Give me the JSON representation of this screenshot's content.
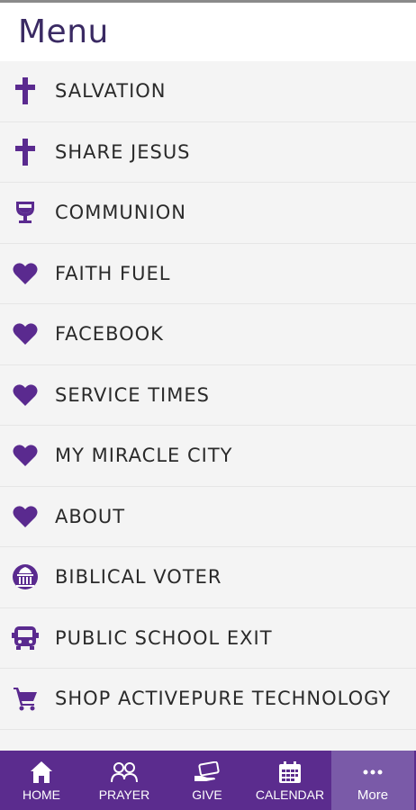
{
  "header": {
    "title": "Menu"
  },
  "colors": {
    "accent": "#5b2c8e",
    "active_tab": "#7a5aa8",
    "icon": "#5a2a8f"
  },
  "menu": {
    "items": [
      {
        "label": "SALVATION",
        "icon": "cross-icon"
      },
      {
        "label": "SHARE JESUS",
        "icon": "cross-icon"
      },
      {
        "label": "COMMUNION",
        "icon": "chalice-icon"
      },
      {
        "label": "FAITH FUEL",
        "icon": "heart-icon"
      },
      {
        "label": "FACEBOOK",
        "icon": "heart-icon"
      },
      {
        "label": "SERVICE TIMES",
        "icon": "heart-icon"
      },
      {
        "label": "MY MIRACLE CITY",
        "icon": "heart-icon"
      },
      {
        "label": "ABOUT",
        "icon": "heart-icon"
      },
      {
        "label": "BIBLICAL VOTER",
        "icon": "capitol-icon"
      },
      {
        "label": "PUBLIC SCHOOL EXIT",
        "icon": "bus-icon"
      },
      {
        "label": "SHOP ACTIVEPURE TECHNOLOGY",
        "icon": "cart-icon"
      }
    ]
  },
  "tabbar": {
    "tabs": [
      {
        "label": "HOME",
        "icon": "home-icon"
      },
      {
        "label": "PRAYER",
        "icon": "people-icon"
      },
      {
        "label": "GIVE",
        "icon": "give-icon"
      },
      {
        "label": "CALENDAR",
        "icon": "calendar-icon"
      },
      {
        "label": "More",
        "icon": "more-icon"
      }
    ]
  }
}
